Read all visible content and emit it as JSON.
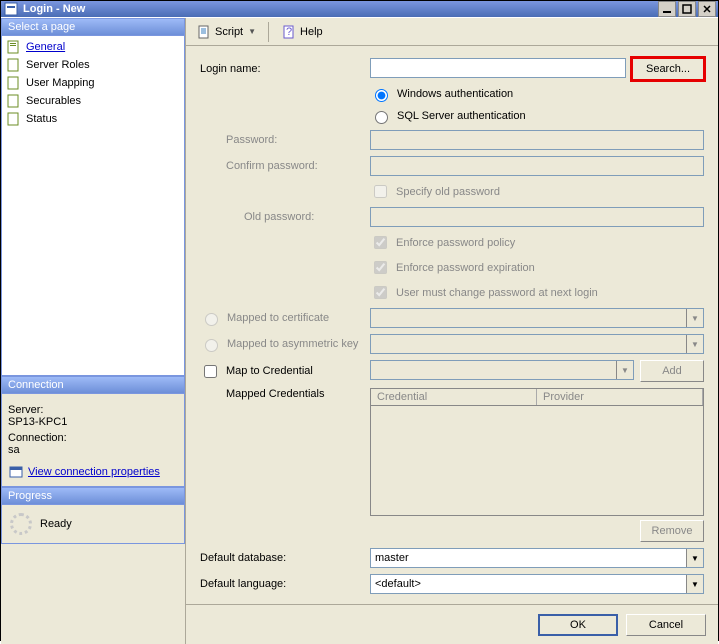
{
  "window": {
    "title": "Login - New"
  },
  "sidebar": {
    "header": "Select a page",
    "items": [
      {
        "label": "General"
      },
      {
        "label": "Server Roles"
      },
      {
        "label": "User Mapping"
      },
      {
        "label": "Securables"
      },
      {
        "label": "Status"
      }
    ]
  },
  "connection": {
    "header": "Connection",
    "serverLabel": "Server:",
    "serverValue": "SP13-KPC1",
    "connLabel": "Connection:",
    "connValue": "sa",
    "viewPropsLink": "View connection properties"
  },
  "progress": {
    "header": "Progress",
    "status": "Ready"
  },
  "toolbar": {
    "script": "Script",
    "help": "Help"
  },
  "form": {
    "loginNameLabel": "Login name:",
    "loginNameValue": "",
    "searchBtn": "Search...",
    "winAuth": "Windows authentication",
    "sqlAuth": "SQL Server authentication",
    "passwordLabel": "Password:",
    "confirmLabel": "Confirm password:",
    "specifyOld": "Specify old password",
    "oldPasswordLabel": "Old password:",
    "enforcePolicy": "Enforce password policy",
    "enforceExpire": "Enforce password expiration",
    "mustChange": "User must change password at next login",
    "mapCert": "Mapped to certificate",
    "mapAsym": "Mapped to asymmetric key",
    "mapCred": "Map to Credential",
    "addBtn": "Add",
    "mappedCredsLabel": "Mapped Credentials",
    "gridCols": {
      "credential": "Credential",
      "provider": "Provider"
    },
    "removeBtn": "Remove",
    "defaultDbLabel": "Default database:",
    "defaultDbValue": "master",
    "defaultLangLabel": "Default language:",
    "defaultLangValue": "<default>"
  },
  "buttons": {
    "ok": "OK",
    "cancel": "Cancel"
  }
}
